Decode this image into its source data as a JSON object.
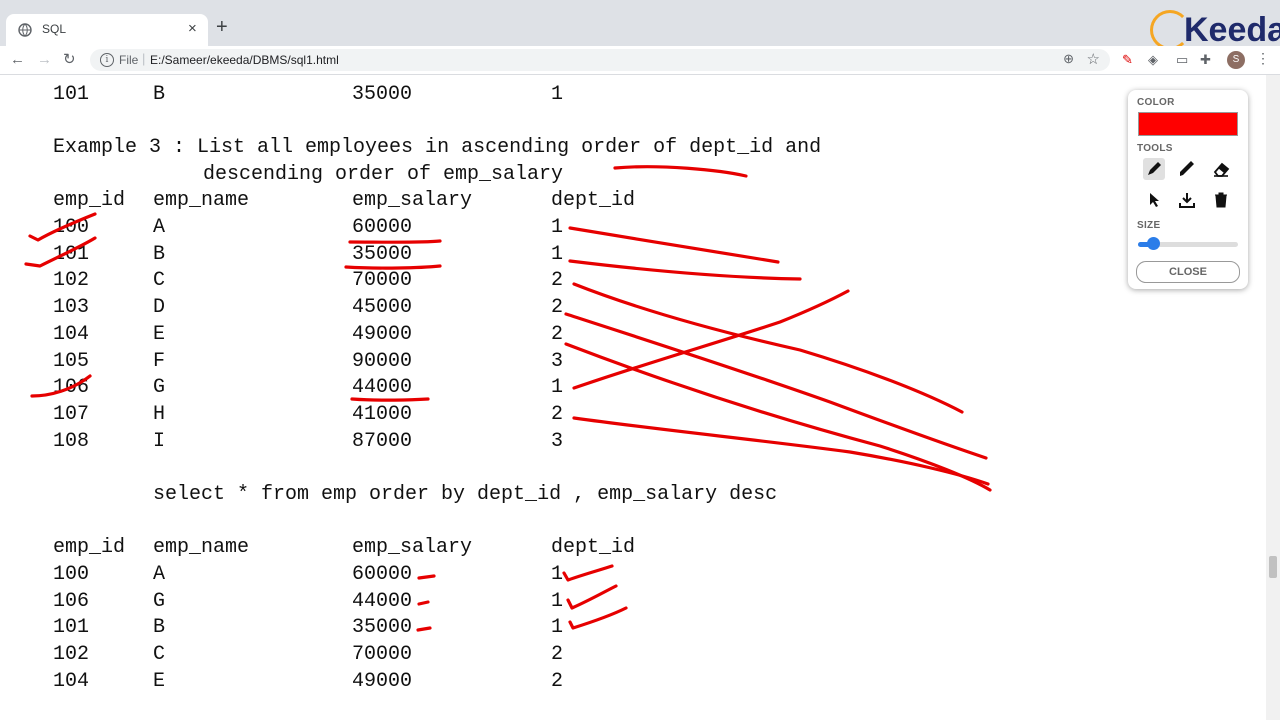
{
  "browser": {
    "tab_title": "SQL",
    "tab_close": "×",
    "new_tab": "+",
    "file_label": "File",
    "url": "E:/Sameer/ekeeda/DBMS/sql1.html",
    "avatar_letter": "S"
  },
  "logo": {
    "text": "Keeda"
  },
  "page": {
    "top_row": [
      "101",
      "B",
      "35000",
      "1"
    ],
    "example_line1": "Example 3 : List all employees in ascending order of dept_id and",
    "example_line2": "descending order of emp_salary",
    "headers": [
      "emp_id",
      "emp_name",
      "emp_salary",
      "dept_id"
    ],
    "table1": [
      [
        "100",
        "A",
        "60000",
        "1"
      ],
      [
        "101",
        "B",
        "35000",
        "1"
      ],
      [
        "102",
        "C",
        "70000",
        "2"
      ],
      [
        "103",
        "D",
        "45000",
        "2"
      ],
      [
        "104",
        "E",
        "49000",
        "2"
      ],
      [
        "105",
        "F",
        "90000",
        "3"
      ],
      [
        "106",
        "G",
        "44000",
        "1"
      ],
      [
        "107",
        "H",
        "41000",
        "2"
      ],
      [
        "108",
        "I",
        "87000",
        "3"
      ]
    ],
    "query": "select * from emp order by dept_id , emp_salary desc",
    "table2": [
      [
        "100",
        "A",
        "60000",
        "1"
      ],
      [
        "106",
        "G",
        "44000",
        "1"
      ],
      [
        "101",
        "B",
        "35000",
        "1"
      ],
      [
        "102",
        "C",
        "70000",
        "2"
      ],
      [
        "104",
        "E",
        "49000",
        "2"
      ]
    ]
  },
  "palette": {
    "color_label": "COLOR",
    "color_value": "#ff0000",
    "tools_label": "TOOLS",
    "size_label": "SIZE",
    "size_level": 0.15,
    "close_label": "CLOSE",
    "tools": [
      "pencil-icon",
      "highlighter-icon",
      "eraser-icon",
      "pointer-icon",
      "download-icon",
      "trash-icon"
    ]
  }
}
